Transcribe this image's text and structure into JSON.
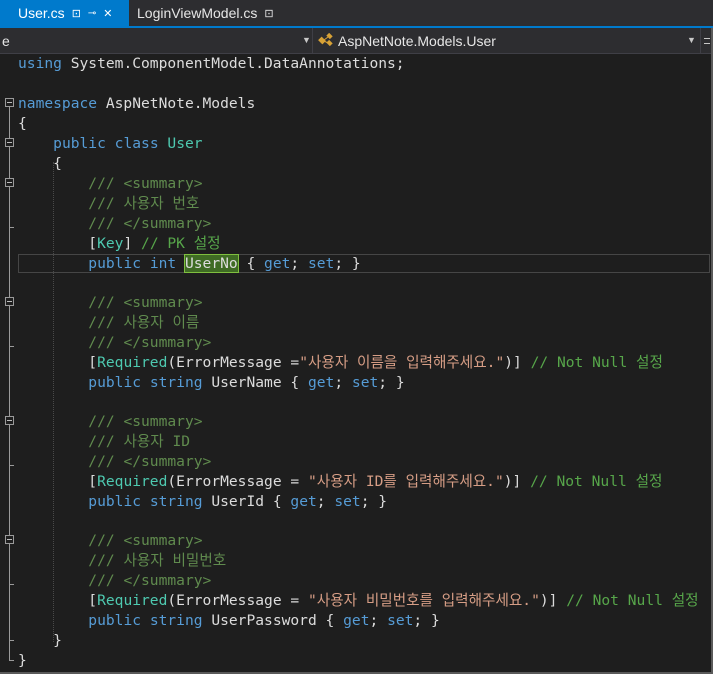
{
  "tabs": [
    {
      "label": "User.cs",
      "pin": "⊡",
      "pin2": "⊸",
      "close": "✕"
    },
    {
      "label": "LoginViewModel.cs",
      "pin": "⊡"
    }
  ],
  "navbar": {
    "project_text": "e",
    "type_text": "AspNetNote.Models.User"
  },
  "code": {
    "l1": {
      "kw": "using",
      "rest": " System.ComponentModel.DataAnnotations;"
    },
    "l3": {
      "kw": "namespace",
      "rest": " AspNetNote.Models"
    },
    "open": "{",
    "close": "}",
    "class_kw1": "public",
    "class_kw2": "class",
    "class_name": "User",
    "summary_open": "/// <summary>",
    "summary_close": "/// </summary>",
    "p1": {
      "desc": "/// 사용자 번호",
      "attr_open": "[",
      "attr_name": "Key",
      "attr_close": "]",
      "comment": " // PK 설정",
      "mod": "public",
      "type": "int",
      "name": "UserNo",
      "acc_open": " { ",
      "get": "get",
      "semi1": "; ",
      "set": "set",
      "acc_close": "; }"
    },
    "p2": {
      "desc": "/// 사용자 이름",
      "attr_open": "[",
      "attr_name": "Required",
      "attr_arg": "(ErrorMessage =",
      "attr_str": "\"사용자 이름을 입력해주세요.\"",
      "attr_close": ")]",
      "comment": " // Not Null 설정",
      "mod": "public",
      "type": "string",
      "name": " UserName",
      "acc_open": " { ",
      "get": "get",
      "semi1": "; ",
      "set": "set",
      "acc_close": "; }"
    },
    "p3": {
      "desc": "/// 사용자 ID",
      "attr_open": "[",
      "attr_name": "Required",
      "attr_arg": "(ErrorMessage = ",
      "attr_str": "\"사용자 ID를 입력해주세요.\"",
      "attr_close": ")]",
      "comment": " // Not Null 설정",
      "mod": "public",
      "type": "string",
      "name": " UserId",
      "acc_open": " { ",
      "get": "get",
      "semi1": "; ",
      "set": "set",
      "acc_close": "; }"
    },
    "p4": {
      "desc": "/// 사용자 비밀번호",
      "attr_open": "[",
      "attr_name": "Required",
      "attr_arg": "(ErrorMessage = ",
      "attr_str": "\"사용자 비밀번호를 입력해주세요.\"",
      "attr_close": ")]",
      "comment": " // Not Null 설정",
      "mod": "public",
      "type": "string",
      "name": " UserPassword",
      "acc_open": " { ",
      "get": "get",
      "semi1": "; ",
      "set": "set",
      "acc_close": "; }"
    }
  },
  "colors": {
    "keyword": "#569cd6",
    "type": "#4ec9b0",
    "comment": "#57a64a",
    "string": "#d69d85",
    "accent": "#007acc"
  }
}
